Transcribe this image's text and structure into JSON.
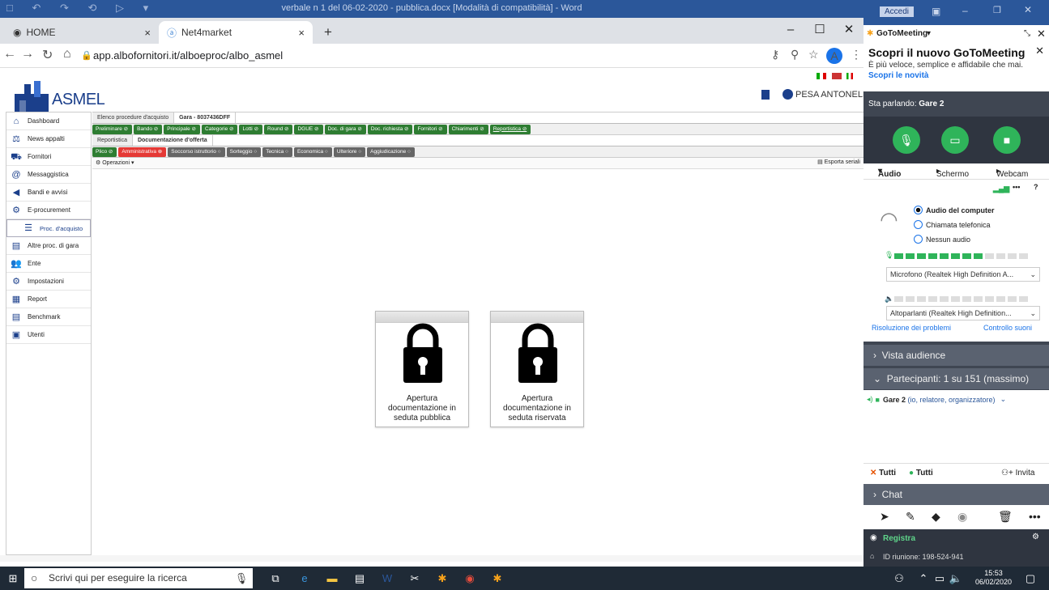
{
  "word_title": "verbale n 1 del 06-02-2020 - pubblica.docx [Modalità di compatibilità] - Word",
  "word_quick_access": "□ ↶ ↷ ⟲ ▷ ▾",
  "browser": {
    "tabs": [
      {
        "label": "HOME",
        "active": false
      },
      {
        "label": "Net4market",
        "active": true
      }
    ],
    "url": "app.albofornitori.it/alboeproc/albo_asmel",
    "profile_initial": "A",
    "new_tab": "+",
    "close": "×",
    "win_min": "–",
    "win_max": "☐",
    "win_close": "✕"
  },
  "site": {
    "logo_text": "ASMEL",
    "user_name": "PESA ANTONELLO",
    "sidebar": [
      {
        "label": "Dashboard",
        "icon": "home-icon",
        "glyph": "⌂"
      },
      {
        "label": "News appalti",
        "icon": "scales-icon",
        "glyph": "⚖"
      },
      {
        "label": "Fornitori",
        "icon": "truck-icon",
        "glyph": "⛟"
      },
      {
        "label": "Messaggistica",
        "icon": "at-icon",
        "glyph": "@"
      },
      {
        "label": "Bandi e avvisi",
        "icon": "megaphone-icon",
        "glyph": "◀"
      },
      {
        "label": "E-procurement",
        "icon": "cart-icon",
        "glyph": "⚙"
      },
      {
        "label": "Proc. d'acquisto",
        "icon": "list-icon",
        "glyph": "☰",
        "sub": true
      },
      {
        "label": "Altre proc. di gara",
        "icon": "folder-icon",
        "glyph": "▤"
      },
      {
        "label": "Ente",
        "icon": "people-icon",
        "glyph": "👥"
      },
      {
        "label": "Impostazioni",
        "icon": "gear-icon",
        "glyph": "⚙"
      },
      {
        "label": "Report",
        "icon": "chart-icon",
        "glyph": "▦"
      },
      {
        "label": "Benchmark",
        "icon": "document-icon",
        "glyph": "▤"
      },
      {
        "label": "Utenti",
        "icon": "user-card-icon",
        "glyph": "▣"
      }
    ],
    "top_tabs": [
      {
        "label": "Elenco procedure d'acquisto",
        "active": false
      },
      {
        "label": "Gara - 8037436DFF",
        "active": true
      }
    ],
    "steps": [
      {
        "label": "Preliminare",
        "style": "green"
      },
      {
        "label": "Bando",
        "style": "green"
      },
      {
        "label": "Principale",
        "style": "green"
      },
      {
        "label": "Categorie",
        "style": "green"
      },
      {
        "label": "Lotti",
        "style": "green"
      },
      {
        "label": "Round",
        "style": "green"
      },
      {
        "label": "DGUE",
        "style": "green"
      },
      {
        "label": "Doc. di gara",
        "style": "green"
      },
      {
        "label": "Doc. richiesta",
        "style": "green"
      },
      {
        "label": "Fornitori",
        "style": "green"
      },
      {
        "label": "Chiarimenti",
        "style": "green"
      },
      {
        "label": "Reportistica",
        "style": "green link"
      }
    ],
    "sub_tabs": [
      {
        "label": "Reportistica",
        "active": false
      },
      {
        "label": "Documentazione d'offerta",
        "active": true
      }
    ],
    "phases": [
      {
        "label": "Plico",
        "style": "green"
      },
      {
        "label": "Amministrativa",
        "style": "red"
      },
      {
        "label": "Soccorso istruttorio",
        "style": "grey"
      },
      {
        "label": "Sorteggio",
        "style": "grey"
      },
      {
        "label": "Tecnica",
        "style": "grey"
      },
      {
        "label": "Economica",
        "style": "grey"
      },
      {
        "label": "Ulteriore",
        "style": "grey"
      },
      {
        "label": "Aggiudicazione",
        "style": "grey"
      }
    ],
    "export_label": "Esporta seriali",
    "operations_label": "Operazioni",
    "lock_public": "Apertura documentazione in seduta pubblica",
    "lock_private": "Apertura documentazione in seduta riservata"
  },
  "gtm": {
    "header": "GoToMeeting",
    "promo_title": "Scopri il nuovo GoToMeeting",
    "promo_sub": "È più veloce, semplice e affidabile che mai.",
    "promo_link": "Scopri le novità",
    "speaking_label": "Sta parlando:",
    "speaking_name": "Gare 2",
    "tabs": [
      "Audio",
      "Schermo",
      "Webcam"
    ],
    "audio_options": [
      {
        "label": "Audio del computer",
        "selected": true
      },
      {
        "label": "Chiamata telefonica",
        "selected": false
      },
      {
        "label": "Nessun audio",
        "selected": false
      }
    ],
    "mic_level": 8,
    "mic_device": "Microfono (Realtek High Definition A...",
    "speaker_device": "Altoparlanti (Realtek High Definition...",
    "troubleshoot": "Risoluzione dei problemi",
    "sound_check": "Controllo suoni",
    "audience": "Vista audience",
    "participants": "Partecipanti:  1 su 151 (massimo)",
    "participant": "Gare 2",
    "participant_role": "(io, relatore, organizzatore)",
    "mute_all": "Tutti",
    "unmute_all": "Tutti",
    "invite": "Invita",
    "chat": "Chat",
    "record": "Registra",
    "meeting_id": "ID riunione: 198-524-941"
  },
  "word_login": "Accedi",
  "taskbar": {
    "search_placeholder": "Scrivi qui per eseguire la ricerca",
    "time": "15:53",
    "date": "06/02/2020"
  },
  "colors": {
    "asmel_blue": "#1b3f8b",
    "step_green": "#2e7d32",
    "active_red": "#e53935",
    "gtm_green": "#2fb45a"
  }
}
